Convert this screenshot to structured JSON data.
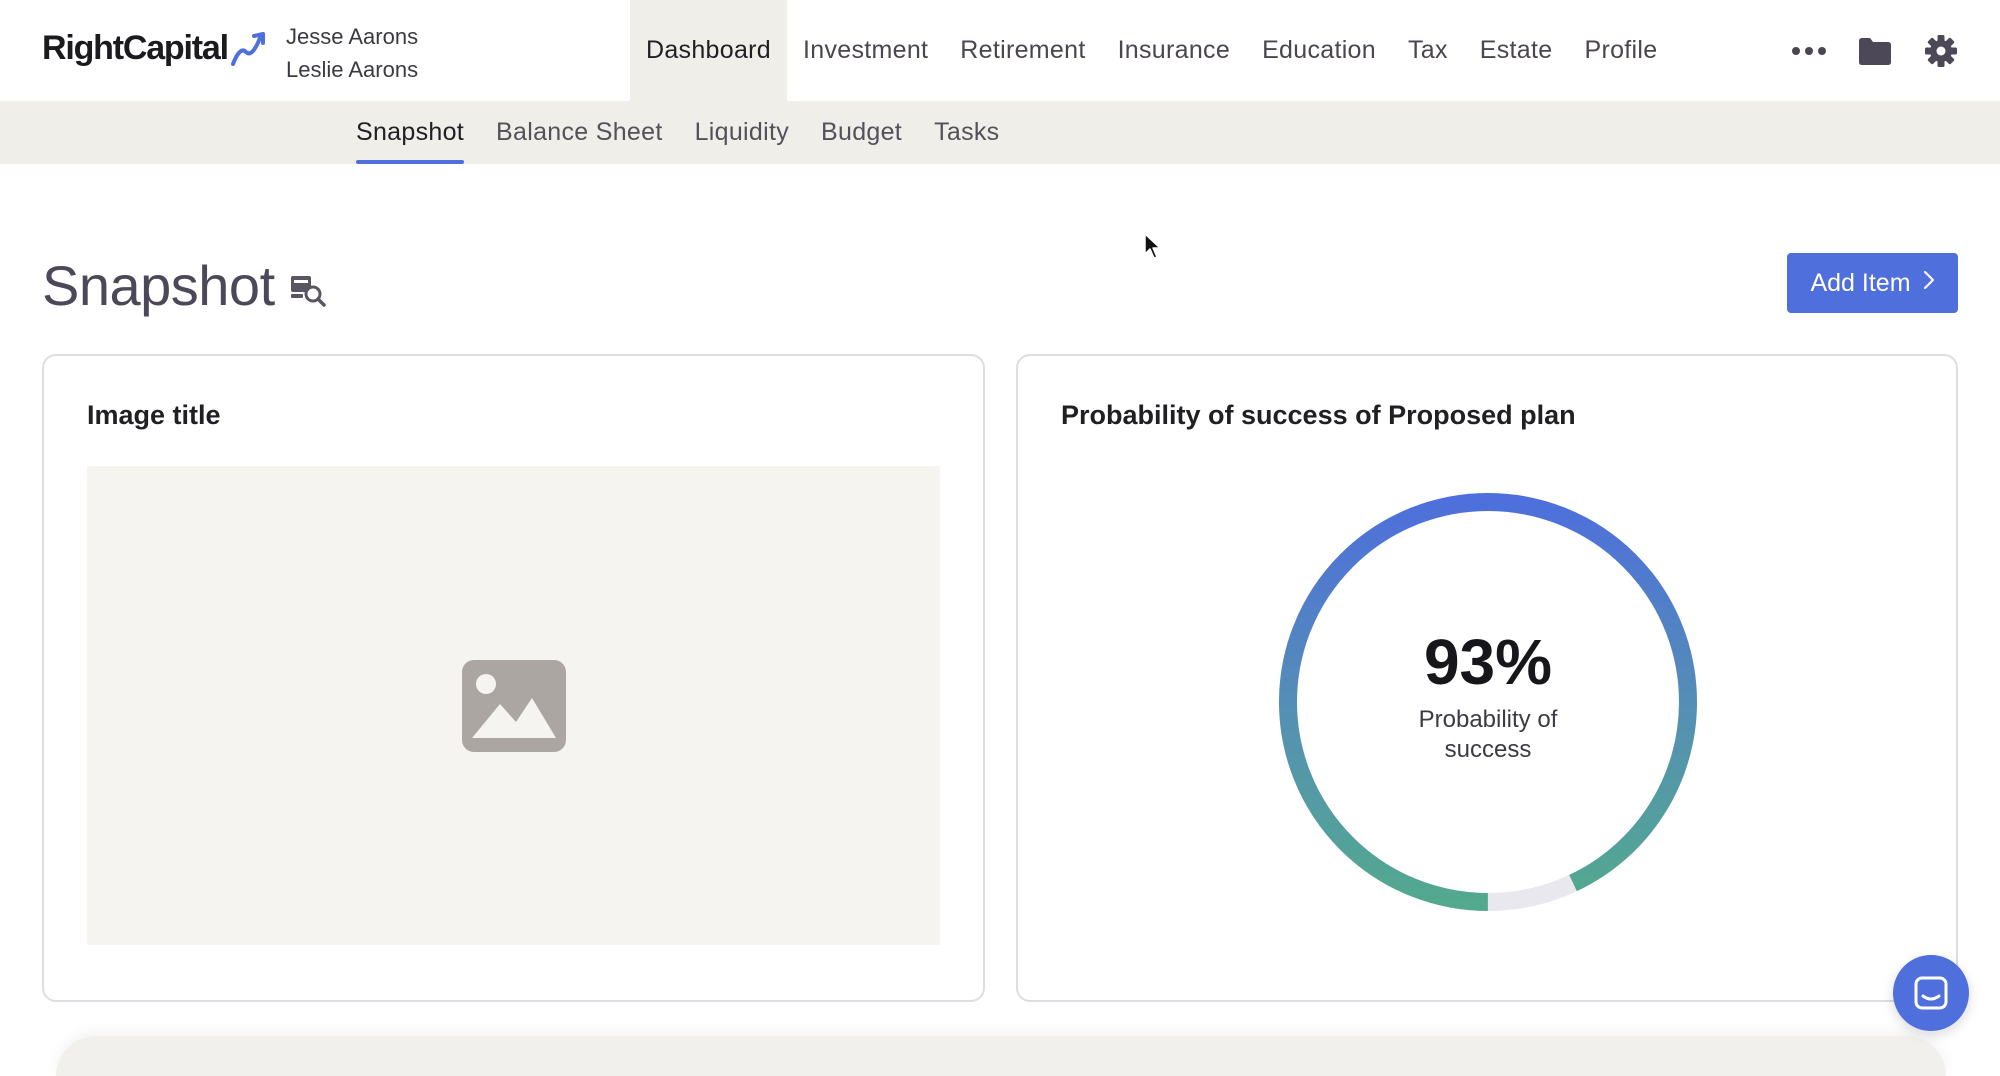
{
  "brand": {
    "name": "RightCapital",
    "accent": "#4e6fdc"
  },
  "clients": [
    "Jesse Aarons",
    "Leslie Aarons"
  ],
  "main_nav": [
    {
      "label": "Dashboard",
      "active": true
    },
    {
      "label": "Investment"
    },
    {
      "label": "Retirement"
    },
    {
      "label": "Insurance"
    },
    {
      "label": "Education"
    },
    {
      "label": "Tax"
    },
    {
      "label": "Estate"
    },
    {
      "label": "Profile"
    }
  ],
  "nav_icons": [
    "more-icon",
    "folder-icon",
    "gear-icon"
  ],
  "sub_nav": [
    {
      "label": "Snapshot",
      "active": true
    },
    {
      "label": "Balance Sheet"
    },
    {
      "label": "Liquidity"
    },
    {
      "label": "Budget"
    },
    {
      "label": "Tasks"
    }
  ],
  "page": {
    "title": "Snapshot",
    "add_button_label": "Add Item"
  },
  "cards": {
    "image_card": {
      "title": "Image title"
    },
    "probability_card": {
      "title": "Probability of success of Proposed plan",
      "value_text": "93%",
      "value": 0.93,
      "label": "Probability of success"
    }
  }
}
